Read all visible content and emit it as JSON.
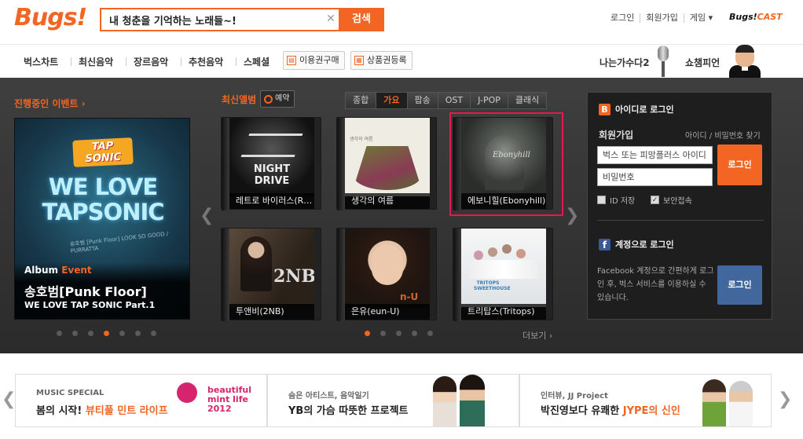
{
  "brand": {
    "logo": "Bugs!",
    "cast_logo": "Bugs!",
    "cast_suffix": "CAST"
  },
  "search": {
    "value": "내 청춘을 기억하는 노래들~!",
    "button": "검색"
  },
  "util_links": [
    "로그인",
    "회원가입",
    "게임 ▾"
  ],
  "nav": {
    "items": [
      "벅스차트",
      "최신음악",
      "장르음악",
      "추천음악",
      "스페셜"
    ],
    "buy_ticket": "이용권구매",
    "register_coupon": "상품권등록",
    "right_1": "나는가수다2",
    "right_2": "쇼챔피언"
  },
  "events": {
    "title": "진행중인 이벤트 ›",
    "banner": {
      "tap_logo": "TAP SONIC",
      "headline_1": "WE LOVE",
      "headline_2": "TAPSONIC",
      "small_text": "송호범 [Punk Floor] LOOK SO GOOD / PURRATTA",
      "label_album": "Album",
      "label_event": "Event",
      "title": "송호범[Punk Floor]",
      "subtitle": "WE LOVE TAP SONIC Part.1"
    }
  },
  "new_albums": {
    "title": "최신앨범",
    "reserve": "예약",
    "genres": [
      "종합",
      "가요",
      "팝송",
      "OST",
      "J-POP",
      "클래식"
    ],
    "active_genre": "가요",
    "albums": [
      {
        "caption": "레트로 바이러스(R…",
        "cover_text": "NIGHT DRIVE"
      },
      {
        "caption": "생각의 여름",
        "cover_text": "생각의 여름"
      },
      {
        "caption": "에보니힐(Ebonyhill)",
        "cover_text": "Ebonyhill"
      },
      {
        "caption": "투앤비(2NB)",
        "cover_text": "2NB"
      },
      {
        "caption": "은유(eun-U)",
        "cover_text": "n-U"
      },
      {
        "caption": "트리탑스(Tritops)",
        "cover_text": "TRITOPS SWEETHOUSE"
      }
    ],
    "more": "더보기 ›"
  },
  "login": {
    "id_login": "아이디로 로그인",
    "join": "회원가입",
    "find": "아이디 / 비밀번호 찾기",
    "id_placeholder": "벅스 또는 피망플러스 아이디",
    "pw_placeholder": "비밀번호",
    "login_btn": "로그인",
    "save_id": "ID 저장",
    "secure": "보안접속",
    "account_login": "계정으로 로그인",
    "fb_desc": "Facebook 계정으로 간편하게 로그인 후, 벅스 서비스를 이용하실 수 있습니다.",
    "fb_login_btn": "로그인"
  },
  "promos": [
    {
      "label": "MUSIC SPECIAL",
      "title_a": "봄의 시작! ",
      "title_b": "뷰티풀 민트 라이프",
      "art": "beautiful mint life 2012"
    },
    {
      "label": "숨은 아티스트, 음악일기",
      "title_a": "YB의 가슴 따뜻한 프로젝트",
      "title_b": ""
    },
    {
      "label": "인터뷰, JJ Project",
      "title_a": "박진영보다 유쾌한 ",
      "title_b": "JYPE의 신인"
    }
  ],
  "colors": {
    "accent": "#f26522",
    "highlight": "#e5194c",
    "facebook": "#3b5998"
  }
}
